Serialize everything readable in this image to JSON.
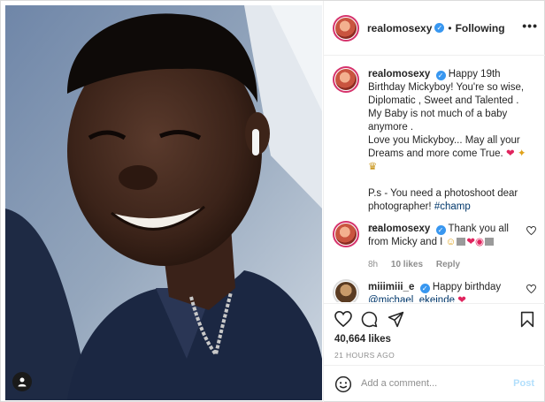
{
  "post": {
    "username": "realomosexy",
    "separator": "•",
    "follow_state": "Following",
    "more_icon": "more-icon"
  },
  "caption": {
    "username": "realomosexy",
    "text_1": "Happy 19th Birthday Mickyboy! You're so wise, Diplomatic , Sweet and Talented . My Baby is not much of a baby anymore .",
    "text_2": "Love you Mickyboy... May all your Dreams and more come True.",
    "text_3": "P.s - You need a photoshoot dear photographer!",
    "hashtag": "#champ",
    "age": "21h"
  },
  "comments": [
    {
      "username": "realomosexy",
      "text": "Thank you all from Micky and I",
      "age": "8h",
      "likes": "10 likes",
      "reply": "Reply"
    },
    {
      "username": "miiimiii_e",
      "text": "Happy birthday",
      "mention": "@michael_ekeinde"
    }
  ],
  "actions": {
    "likes": "40,664 likes",
    "timestamp": "21 HOURS AGO"
  },
  "add_comment": {
    "placeholder": "Add a comment...",
    "post_label": "Post"
  },
  "colors": {
    "story_ring": "#d6336c",
    "verified": "#3897f0",
    "post_disabled": "#b2dffc"
  }
}
